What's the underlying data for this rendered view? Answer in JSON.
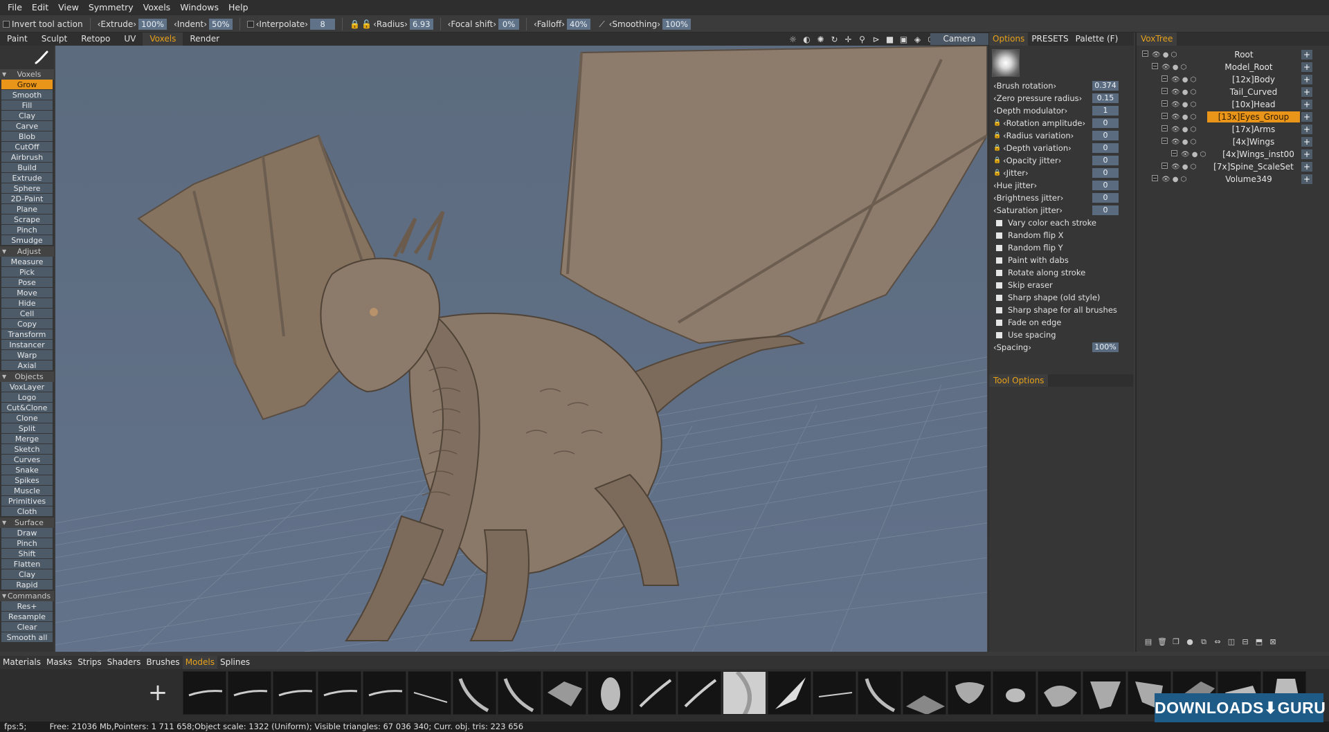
{
  "menu": [
    "File",
    "Edit",
    "View",
    "Symmetry",
    "Voxels",
    "Windows",
    "Help"
  ],
  "toolbar": {
    "invert": "Invert tool action",
    "extrude_label": "‹Extrude›",
    "extrude_value": "100%",
    "indent_label": "‹Indent›",
    "indent_value": "50%",
    "interpolate_label": "‹Interpolate›",
    "interpolate_value": "8",
    "radius_label": "‹Radius›",
    "radius_value": "6.93",
    "focal_label": "‹Focal shift›",
    "focal_value": "0%",
    "falloff_label": "‹Falloff›",
    "falloff_value": "40%",
    "smoothing_label": "‹Smoothing›",
    "smoothing_value": "100%"
  },
  "rooms": [
    "Paint",
    "Sculpt",
    "Retopo",
    "UV",
    "Voxels",
    "Render"
  ],
  "active_room": "Voxels",
  "camera_label": "Camera",
  "sections": {
    "voxels": "Voxels",
    "adjust": "Adjust",
    "objects": "Objects",
    "surface": "Surface",
    "commands": "Commands"
  },
  "voxel_tools": [
    "Grow",
    "Smooth",
    "Fill",
    "Clay",
    "Carve",
    "Blob",
    "CutOff",
    "Airbrush",
    "Build",
    "Extrude",
    "Sphere",
    "2D-Paint",
    "Plane",
    "Scrape",
    "Pinch",
    "Smudge"
  ],
  "adjust_tools": [
    "Measure",
    "Pick",
    "Pose",
    "Move",
    "Hide",
    "Cell",
    "Copy",
    "Transform",
    "Instancer",
    "Warp",
    "Axial"
  ],
  "object_tools": [
    "VoxLayer",
    "Logo",
    "Cut&Clone",
    "Clone",
    "Split",
    "Merge",
    "Sketch",
    "Curves",
    "Snake",
    "Spikes",
    "Muscle",
    "Primitives",
    "Cloth"
  ],
  "surface_tools": [
    "Draw",
    "Pinch",
    "Shift",
    "Flatten",
    "Clay",
    "Rapid"
  ],
  "command_tools": [
    "Res+",
    "Resample",
    "Clear",
    "Smooth all"
  ],
  "options": {
    "tabs": [
      "Options",
      "PRESETS",
      "Palette (F)"
    ],
    "params": [
      {
        "label": "‹Brush rotation›",
        "value": "0.374",
        "lock": false
      },
      {
        "label": "‹Zero pressure radius›",
        "value": "0.15",
        "lock": false
      },
      {
        "label": "‹Depth modulator›",
        "value": "1",
        "lock": false
      },
      {
        "label": "‹Rotation amplitude›",
        "value": "0",
        "lock": true
      },
      {
        "label": "‹Radius variation›",
        "value": "0",
        "lock": true
      },
      {
        "label": "‹Depth variation›",
        "value": "0",
        "lock": true
      },
      {
        "label": "‹Opacity jitter›",
        "value": "0",
        "lock": true
      },
      {
        "label": "‹Jitter›",
        "value": "0",
        "lock": true
      },
      {
        "label": "‹Hue jitter›",
        "value": "0",
        "lock": false
      },
      {
        "label": "‹Brightness jitter›",
        "value": "0",
        "lock": false
      },
      {
        "label": "‹Saturation jitter›",
        "value": "0",
        "lock": false
      }
    ],
    "checks": [
      "Vary color each stroke",
      "Random flip X",
      "Random flip Y",
      "Paint with dabs",
      "Rotate along stroke",
      "Skip eraser",
      "Sharp shape (old style)",
      "Sharp shape for all brushes",
      "Fade on edge",
      "Use spacing"
    ],
    "spacing_label": "‹Spacing›",
    "spacing_value": "100%",
    "tool_options_tab": "Tool Options"
  },
  "voxtree": {
    "tab": "VoxTree",
    "items": [
      {
        "name": "Root",
        "level": 0,
        "active": false
      },
      {
        "name": "Model_Root",
        "level": 1,
        "active": false
      },
      {
        "name": "[12x]Body",
        "level": 2,
        "active": false
      },
      {
        "name": "Tail_Curved",
        "level": 2,
        "active": false
      },
      {
        "name": "[10x]Head",
        "level": 2,
        "active": false
      },
      {
        "name": "[13x]Eyes_Group",
        "level": 2,
        "active": true
      },
      {
        "name": "[17x]Arms",
        "level": 2,
        "active": false
      },
      {
        "name": "[4x]Wings",
        "level": 2,
        "active": false
      },
      {
        "name": "[4x]Wings_inst00",
        "level": 3,
        "active": false
      },
      {
        "name": "[7x]Spine_ScaleSet",
        "level": 2,
        "active": false
      },
      {
        "name": "Volume349",
        "level": 1,
        "active": false
      }
    ]
  },
  "shelf": {
    "tabs": [
      "Materials",
      "Masks",
      "Strips",
      "Shaders",
      "Brushes",
      "Models",
      "Splines"
    ],
    "active": "Models"
  },
  "status": {
    "fps": "fps:5;",
    "info": "Free: 21036 Mb,Pointers: 1 711 658;Object scale: 1322 (Uniform); Visible triangles: 67 036 340; Curr. obj. tris: 223 656"
  },
  "watermark": "DOWNLOADS⬇GURU",
  "colors": {
    "accent": "#e8951a",
    "tool_bg": "#4d5a67",
    "viewport_bg": "#5f6e80",
    "value_bg": "#5f7287"
  }
}
